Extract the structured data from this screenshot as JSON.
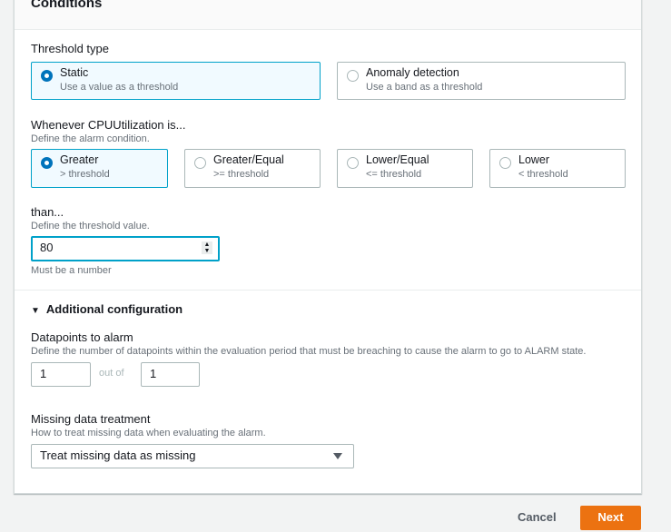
{
  "panel": {
    "title": "Conditions"
  },
  "threshold_type": {
    "label": "Threshold type",
    "options": [
      {
        "title": "Static",
        "subtitle": "Use a value as a threshold",
        "selected": true
      },
      {
        "title": "Anomaly detection",
        "subtitle": "Use a band as a threshold",
        "selected": false
      }
    ]
  },
  "condition": {
    "label": "Whenever CPUUtilization is...",
    "description": "Define the alarm condition.",
    "options": [
      {
        "title": "Greater",
        "subtitle": "> threshold",
        "selected": true
      },
      {
        "title": "Greater/Equal",
        "subtitle": ">= threshold",
        "selected": false
      },
      {
        "title": "Lower/Equal",
        "subtitle": "<= threshold",
        "selected": false
      },
      {
        "title": "Lower",
        "subtitle": "< threshold",
        "selected": false
      }
    ]
  },
  "threshold_value": {
    "label": "than...",
    "description": "Define the threshold value.",
    "value": "80",
    "constraint": "Must be a number"
  },
  "additional_config": {
    "toggle_label": "Additional configuration",
    "expanded": true,
    "datapoints": {
      "label": "Datapoints to alarm",
      "description": "Define the number of datapoints within the evaluation period that must be breaching to cause the alarm to go to ALARM state.",
      "value_a": "1",
      "separator": "out of",
      "value_b": "1"
    },
    "missing_data": {
      "label": "Missing data treatment",
      "description": "How to treat missing data when evaluating the alarm.",
      "selected": "Treat missing data as missing"
    }
  },
  "footer": {
    "cancel_label": "Cancel",
    "next_label": "Next"
  },
  "colors": {
    "accent": "#0073bb",
    "focus": "#00a1c9",
    "primary_button": "#ec7211"
  }
}
